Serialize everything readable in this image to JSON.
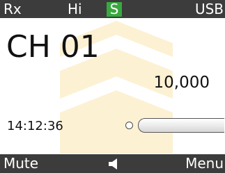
{
  "status_bar": {
    "rx": "Rx",
    "power": "Hi",
    "scan_badge": "S",
    "mode": "USB"
  },
  "main": {
    "channel": "CH 01",
    "frequency": "10,000",
    "time": "14:12:36",
    "signal_level": 0
  },
  "softkeys": {
    "left": "Mute",
    "center_icon": "speaker-icon",
    "right": "Menu"
  },
  "colors": {
    "bar_background": "#3c3c3c",
    "badge_green": "#39a83f",
    "watermark": "#fbe6b0"
  }
}
